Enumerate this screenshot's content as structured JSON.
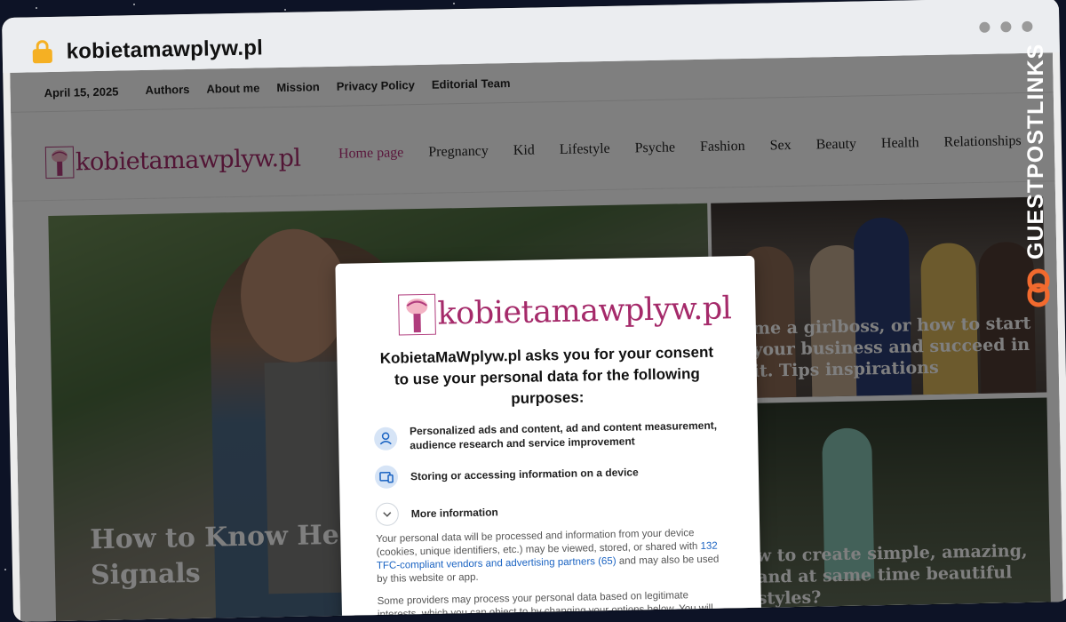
{
  "browser": {
    "url": "kobietamawplyw.pl"
  },
  "topbar": {
    "date": "April 15, 2025",
    "links": [
      "Authors",
      "About me",
      "Mission",
      "Privacy Policy",
      "Editorial Team"
    ]
  },
  "site": {
    "logo_text": "kobietamawplyw.pl",
    "brand_color": "#a52a6a"
  },
  "main_nav": {
    "items": [
      "Home page",
      "Pregnancy",
      "Kid",
      "Lifestyle",
      "Psyche",
      "Fashion",
      "Sex",
      "Beauty",
      "Health",
      "Relationships"
    ],
    "active": "Home page"
  },
  "articles": {
    "main_title": "How to Know He Cares Signals",
    "side1_title": "me a girlboss, or how to start your business and succeed in it. Tips inspirations",
    "side2_title": "w to create simple, amazing, and at same time beautiful styles?"
  },
  "consent": {
    "logo_text": "kobietamawplyw.pl",
    "heading": "KobietaMaWplyw.pl asks you for your consent to use your personal data for the following purposes:",
    "purposes": [
      {
        "icon": "user-icon",
        "text": "Personalized ads and content, ad and content measurement, audience research and service improvement"
      },
      {
        "icon": "device-icon",
        "text": "Storing or accessing information on a device"
      }
    ],
    "more_info": "More information",
    "body1_before": "Your personal data will be processed and information from your device (cookies, unique identifiers, etc.) may be viewed, stored, or shared with ",
    "body1_link": "132 TFC-compliant vendors and advertising partners (65)",
    "body1_after": " and may also be used by this website or app.",
    "body2": "Some providers may process your personal data based on legitimate interests, which you can object to by changing your options below. You will"
  },
  "watermark": {
    "text": "GUESTPOSTLINKS",
    "accent_color": "#f26a2e"
  }
}
